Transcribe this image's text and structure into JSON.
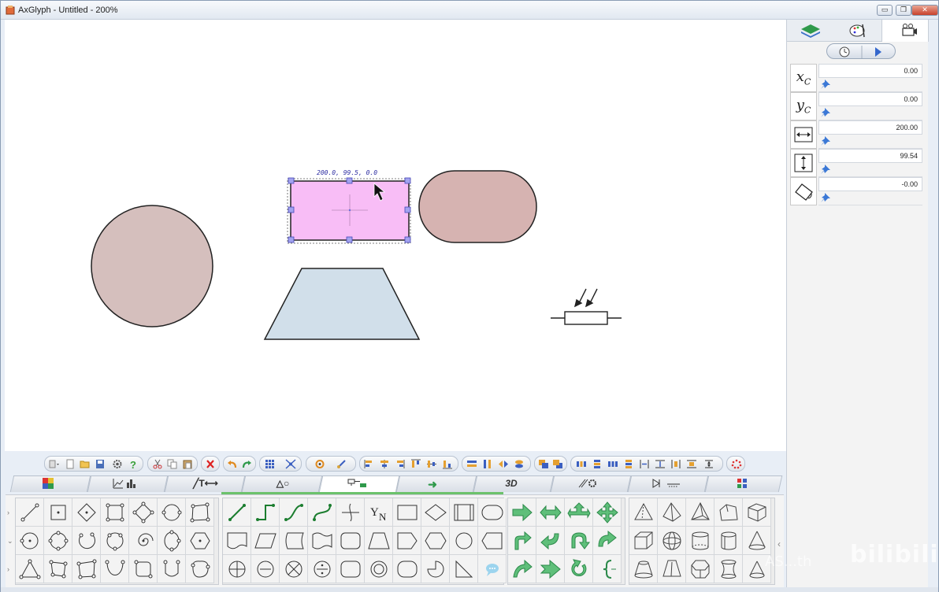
{
  "window": {
    "title": "AxGlyph - Untitled - 200%",
    "controls": {
      "minimize": "▭",
      "maximize": "❐",
      "close": "✕"
    }
  },
  "canvas": {
    "selection_readout": "200.0, 99.5, 0.0",
    "shapes": [
      "circle",
      "rectangle-selected",
      "rounded-capsule",
      "trapezoid",
      "photoresistor-symbol"
    ],
    "colors": {
      "circle_fill": "#d5bfbd",
      "rect_fill": "#f8bdf6",
      "capsule_fill": "#d6b3b1",
      "trapezoid_fill": "#d1dfea",
      "handle": "#8e8ee0"
    }
  },
  "right_panel": {
    "tabs": [
      "layers-icon",
      "palette-icon",
      "camera-icon"
    ],
    "controls": [
      "timer-icon",
      "play-icon"
    ],
    "properties": [
      {
        "symbol": "x",
        "subscript": "C",
        "value": "0.00"
      },
      {
        "symbol": "y",
        "subscript": "C",
        "value": "0.00"
      },
      {
        "symbol": "width-icon",
        "value": "200.00"
      },
      {
        "symbol": "height-icon",
        "value": "99.54"
      },
      {
        "symbol": "rotation-icon",
        "value": "-0.00"
      }
    ]
  },
  "toolbar": {
    "groups": 12,
    "icons": [
      "list-icon",
      "new-icon",
      "open-icon",
      "save-icon",
      "settings-icon",
      "help-icon",
      "cut-icon",
      "copy-icon",
      "paste-icon",
      "delete-icon",
      "undo-icon",
      "redo-icon",
      "grid-icon",
      "snap-icon",
      "rotate-icon",
      "edit-node-icon",
      "align-left-icon",
      "align-center-icon",
      "align-right-icon",
      "align-top-icon",
      "align-middle-icon",
      "align-bottom-icon",
      "same-width-icon",
      "same-height-icon",
      "same-size-icon",
      "flip-h-icon",
      "flip-v-icon",
      "front-icon",
      "back-icon",
      "distribute-icon",
      "distribute-v-icon",
      "space-icon",
      "space-v-icon",
      "space-h-icon",
      "space2-icon",
      "space3-icon",
      "more-icon"
    ]
  },
  "category_tabs": [
    {
      "label": "",
      "icon": "color-icon"
    },
    {
      "label": "",
      "icon": "chart-icon"
    },
    {
      "label": "╱T⟷",
      "icon": "line-text-icon"
    },
    {
      "label": "△○",
      "icon": "shapes-icon"
    },
    {
      "label": "",
      "icon": "flowchart-icon"
    },
    {
      "label": "➜",
      "icon": "arrow-icon"
    },
    {
      "label": "3D",
      "icon": "3d-icon"
    },
    {
      "label": "",
      "icon": "physics-icon"
    },
    {
      "label": "",
      "icon": "circuit-icon"
    },
    {
      "label": "",
      "icon": "more-icon"
    }
  ],
  "palette_text": {
    "yn_label": "Y",
    "yn_sub": "N"
  },
  "watermark": {
    "brand": "bilibili",
    "handle": "AS...th"
  }
}
